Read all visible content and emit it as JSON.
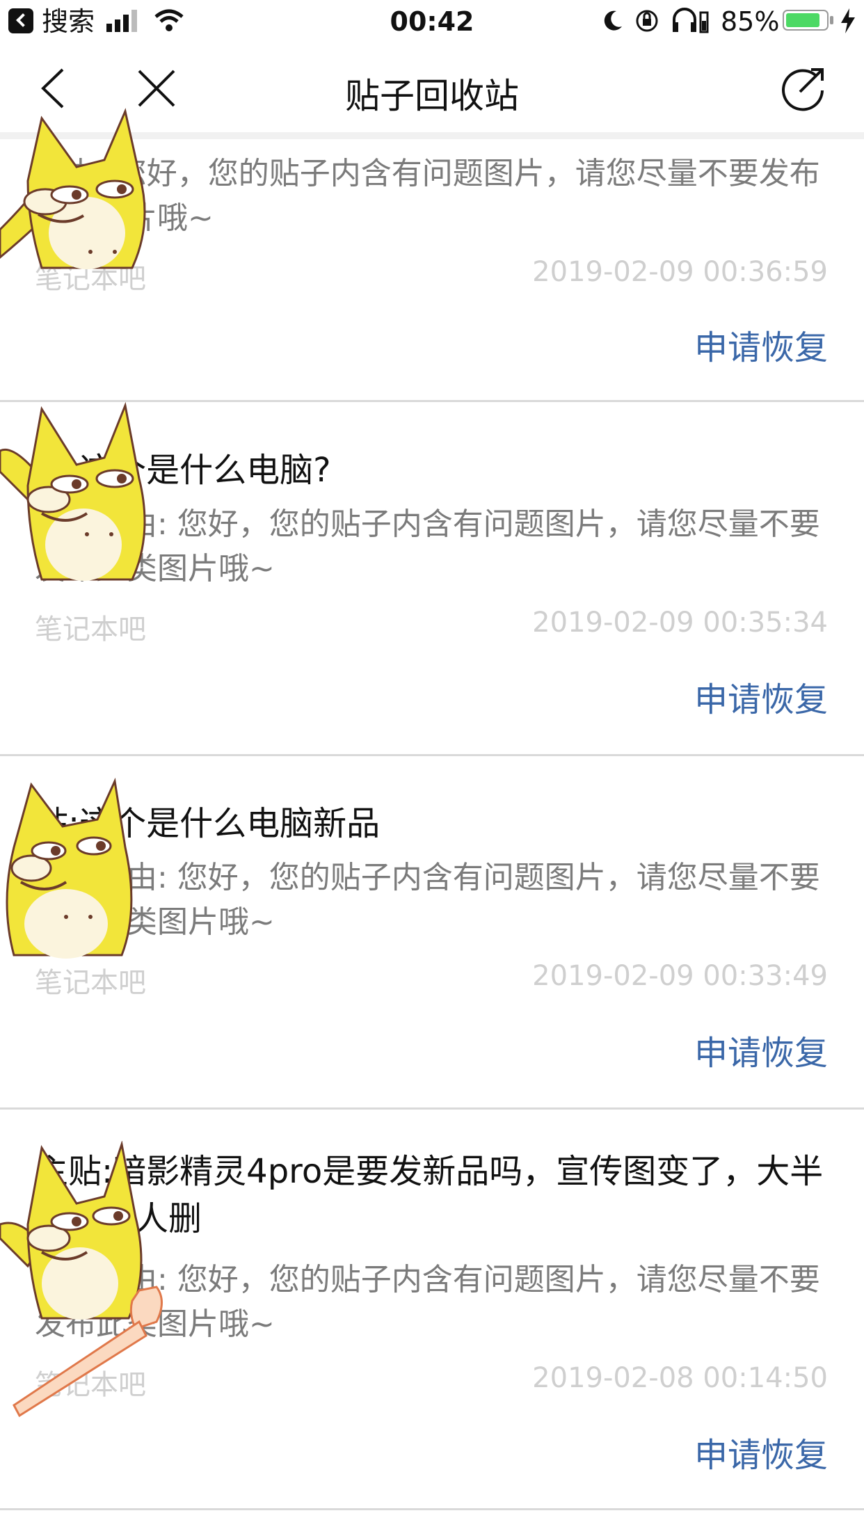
{
  "status_bar": {
    "back_app": "搜索",
    "time": "00:42",
    "battery_percent": "85%",
    "battery_level": 0.85
  },
  "nav": {
    "title": "贴子回收站"
  },
  "cards": [
    {
      "title": "",
      "reason": "理由: 您好，您的贴子内含有问题图片，请您尽量不要发布此类图片哦~",
      "forum": "笔记本吧",
      "time": "2019-02-09 00:36:59",
      "action": "申请恢复"
    },
    {
      "title": "贴:这个是什么电脑?",
      "reason": "删除理由: 您好，您的贴子内含有问题图片，请您尽量不要发布此类图片哦~",
      "forum": "笔记本吧",
      "time": "2019-02-09 00:35:34",
      "action": "申请恢复"
    },
    {
      "title": "贴:这个是什么电脑新品",
      "reason": "删除理由: 您好，您的贴子内含有问题图片，请您尽量不要发布此类图片哦~",
      "forum": "笔记本吧",
      "time": "2019-02-09 00:33:49",
      "action": "申请恢复"
    },
    {
      "title": "主贴:暗影精灵4pro是要发新品吗，宣传图变了，大半夜还有人删",
      "reason": "删除理由: 您好，您的贴子内含有问题图片，请您尽量不要发布此类图片哦~",
      "forum": "笔记本吧",
      "time": "2019-02-08 00:14:50",
      "action": "申请恢复"
    }
  ]
}
